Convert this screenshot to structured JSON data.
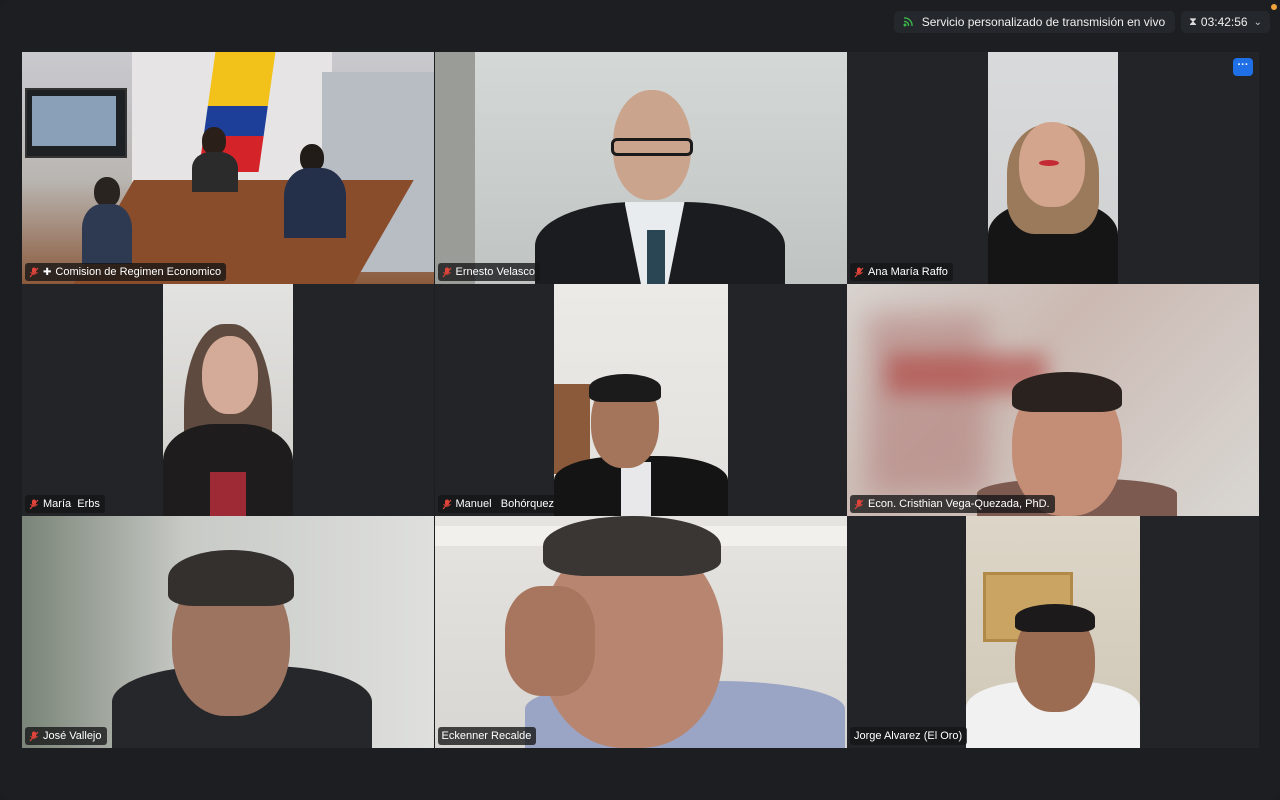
{
  "topbar": {
    "live_label": "Servicio personalizado de transmisión en vivo",
    "timer": "03:42:56",
    "live_icon": "signal-icon",
    "timer_icon": "hourglass-icon"
  },
  "tiles": [
    {
      "name": "Comision de Regimen Economico",
      "muted": true,
      "pinned": true
    },
    {
      "name": "Ernesto Velasco",
      "muted": true
    },
    {
      "name": "Ana María Raffo",
      "muted": true
    },
    {
      "name": "María  Erbs",
      "muted": true
    },
    {
      "name": "Manuel   Bohórquez",
      "muted": true
    },
    {
      "name": "Econ. Cristhian Vega-Quezada, PhD.",
      "muted": true
    },
    {
      "name": "José Vallejo",
      "muted": true
    },
    {
      "name": "Eckenner Recalde",
      "muted": false
    },
    {
      "name": "Jorge Alvarez (El Oro)",
      "muted": false
    }
  ],
  "more_button_label": "···",
  "colors": {
    "accent": "#1f6fe6",
    "muted_icon": "#e0443a",
    "live_icon": "#3bb54a"
  }
}
